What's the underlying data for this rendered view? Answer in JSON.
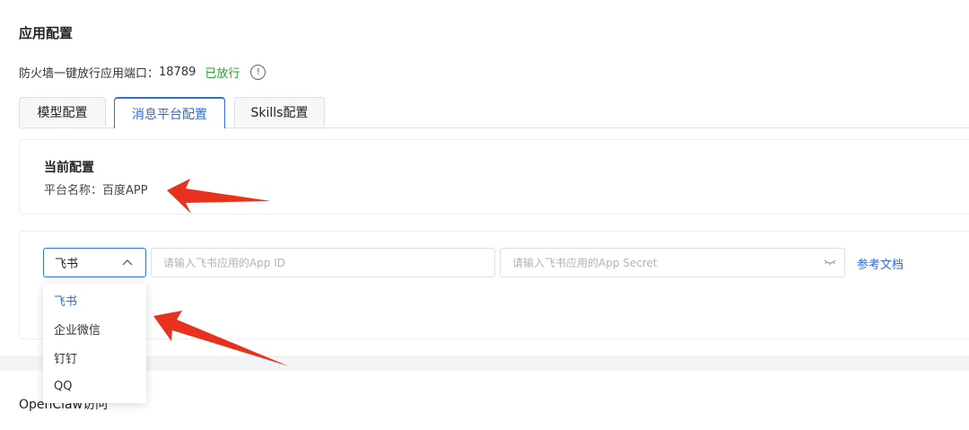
{
  "section": {
    "title": "应用配置"
  },
  "firewall": {
    "label": "防火墙一键放行应用端口：",
    "port": "18789",
    "status": "已放行",
    "info_icon": "!"
  },
  "tabs": [
    {
      "label": "模型配置",
      "active": false
    },
    {
      "label": "消息平台配置",
      "active": true
    },
    {
      "label": "Skills配置",
      "active": false
    }
  ],
  "current_config": {
    "title": "当前配置",
    "platform_label": "平台名称：",
    "platform_value": "百度APP"
  },
  "platform_form": {
    "selected": "飞书",
    "app_id_placeholder": "请输入飞书应用的App ID",
    "app_secret_placeholder": "请输入飞书应用的App Secret",
    "doc_link": "参考文档"
  },
  "dropdown_options": [
    "飞书",
    "企业微信",
    "钉钉",
    "QQ"
  ],
  "next_section": {
    "title": "OpenClaw访问"
  },
  "colors": {
    "accent": "#3370e0",
    "success": "#2aa52a",
    "arrow": "#e8321e"
  },
  "icons": {
    "chevron": "chevron-up-icon",
    "eye": "eye-closed-icon",
    "info": "info-circle-icon"
  }
}
